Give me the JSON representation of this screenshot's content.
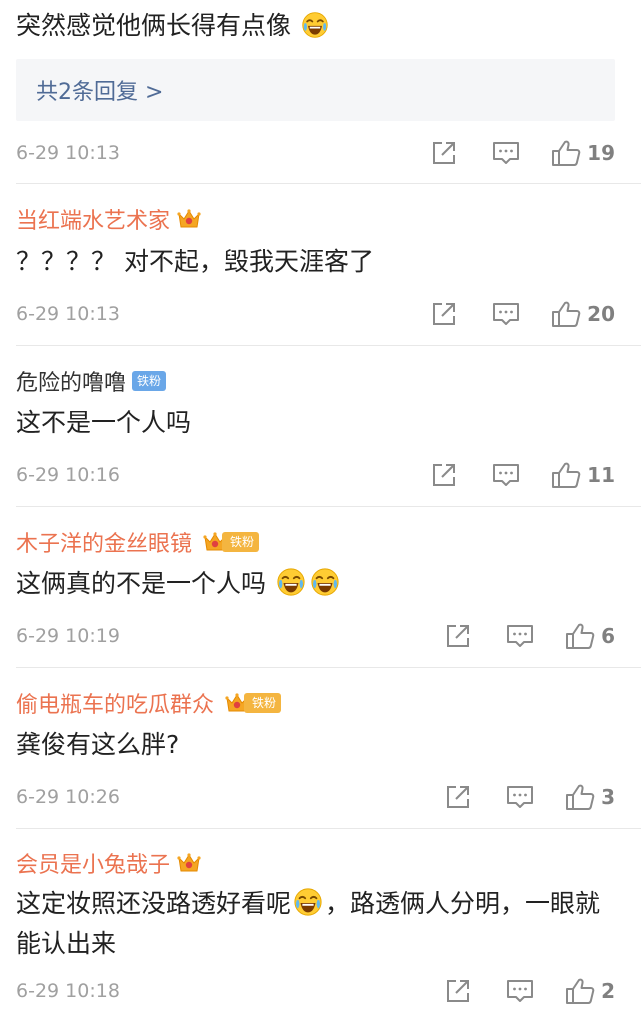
{
  "first_comment": {
    "text": "突然感觉他俩长得有点像",
    "emoji": "laugh-cry-emoji",
    "replies_label": "共2条回复 >",
    "timestamp": "6-29 10:13",
    "likes": "19"
  },
  "comments": [
    {
      "username": "当红端水艺术家",
      "badge": "vip-crown",
      "text": "？？？？ 对不起，毁我天涯客了",
      "timestamp": "6-29 10:13",
      "likes": "20"
    },
    {
      "username": "危险的噜噜",
      "badge": "fan",
      "badge_text": "铁粉",
      "text": "这不是一个人吗",
      "timestamp": "6-29 10:16",
      "likes": "11"
    },
    {
      "username": "木子洋的金丝眼镜",
      "badge": "vip-crown-fan",
      "badge_text": "铁粉",
      "text": "这俩真的不是一个人吗",
      "timestamp": "6-29 10:19",
      "likes": "6"
    },
    {
      "username": "偷电瓶车的吃瓜群众",
      "badge": "vip-crown-fan",
      "badge_text": "铁粉",
      "text": "龚俊有这么胖?",
      "timestamp": "6-29 10:26",
      "likes": "3"
    },
    {
      "username": "会员是小兔哉子",
      "badge": "vip-crown",
      "text_part1": "这定妆照还没路透好看呢",
      "text_part2": "，路透俩人分明，一眼就能认出来",
      "timestamp": "6-29 10:18",
      "likes": "2"
    }
  ],
  "icons": {
    "share": "share-icon",
    "comment": "comment-icon",
    "like": "thumbs-up-icon",
    "crown": "crown-icon",
    "emoji": "laugh-cry-emoji"
  },
  "colors": {
    "username": "#eb7350",
    "link": "#506b96",
    "meta": "#a0a0a0",
    "icon": "#8a8a8a",
    "fan_badge": "#6aa7e8",
    "vip_fan_badge": "#f4b540"
  }
}
